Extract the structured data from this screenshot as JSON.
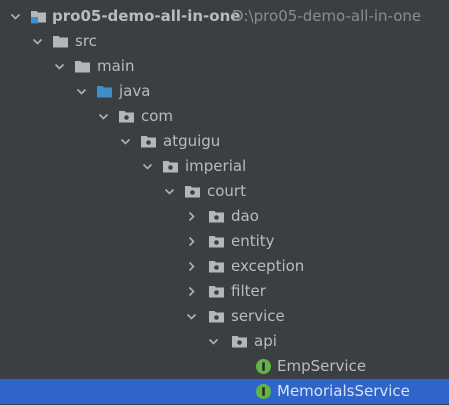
{
  "project_tree": {
    "root": {
      "name": "pro05-demo-all-in-one",
      "path": "D:\\pro05-demo-all-in-one",
      "icon": "module-folder-icon",
      "state": "expanded"
    },
    "src": {
      "name": "src",
      "icon": "folder-icon",
      "state": "expanded"
    },
    "main": {
      "name": "main",
      "icon": "folder-icon",
      "state": "expanded"
    },
    "java": {
      "name": "java",
      "icon": "source-root-folder-icon",
      "state": "expanded"
    },
    "com": {
      "name": "com",
      "icon": "package-icon",
      "state": "expanded"
    },
    "atguigu": {
      "name": "atguigu",
      "icon": "package-icon",
      "state": "expanded"
    },
    "imperial": {
      "name": "imperial",
      "icon": "package-icon",
      "state": "expanded"
    },
    "court": {
      "name": "court",
      "icon": "package-icon",
      "state": "expanded"
    },
    "dao": {
      "name": "dao",
      "icon": "package-icon",
      "state": "collapsed"
    },
    "entity": {
      "name": "entity",
      "icon": "package-icon",
      "state": "collapsed"
    },
    "exception": {
      "name": "exception",
      "icon": "package-icon",
      "state": "collapsed"
    },
    "filter": {
      "name": "filter",
      "icon": "package-icon",
      "state": "collapsed"
    },
    "service": {
      "name": "service",
      "icon": "package-icon",
      "state": "expanded"
    },
    "api": {
      "name": "api",
      "icon": "package-icon",
      "state": "expanded"
    },
    "emp_service": {
      "name": "EmpService",
      "icon": "interface-icon",
      "badge": "I"
    },
    "memorials_service": {
      "name": "MemorialsService",
      "icon": "interface-icon",
      "badge": "I",
      "selected": true
    }
  },
  "colors": {
    "background": "#3c3f41",
    "selection": "#2f65ca",
    "text": "#bbbbbb",
    "path_text": "#8c8c8c",
    "folder": "#b2b7bd",
    "source_folder": "#3d8ec9",
    "interface_badge": "#62b543"
  }
}
